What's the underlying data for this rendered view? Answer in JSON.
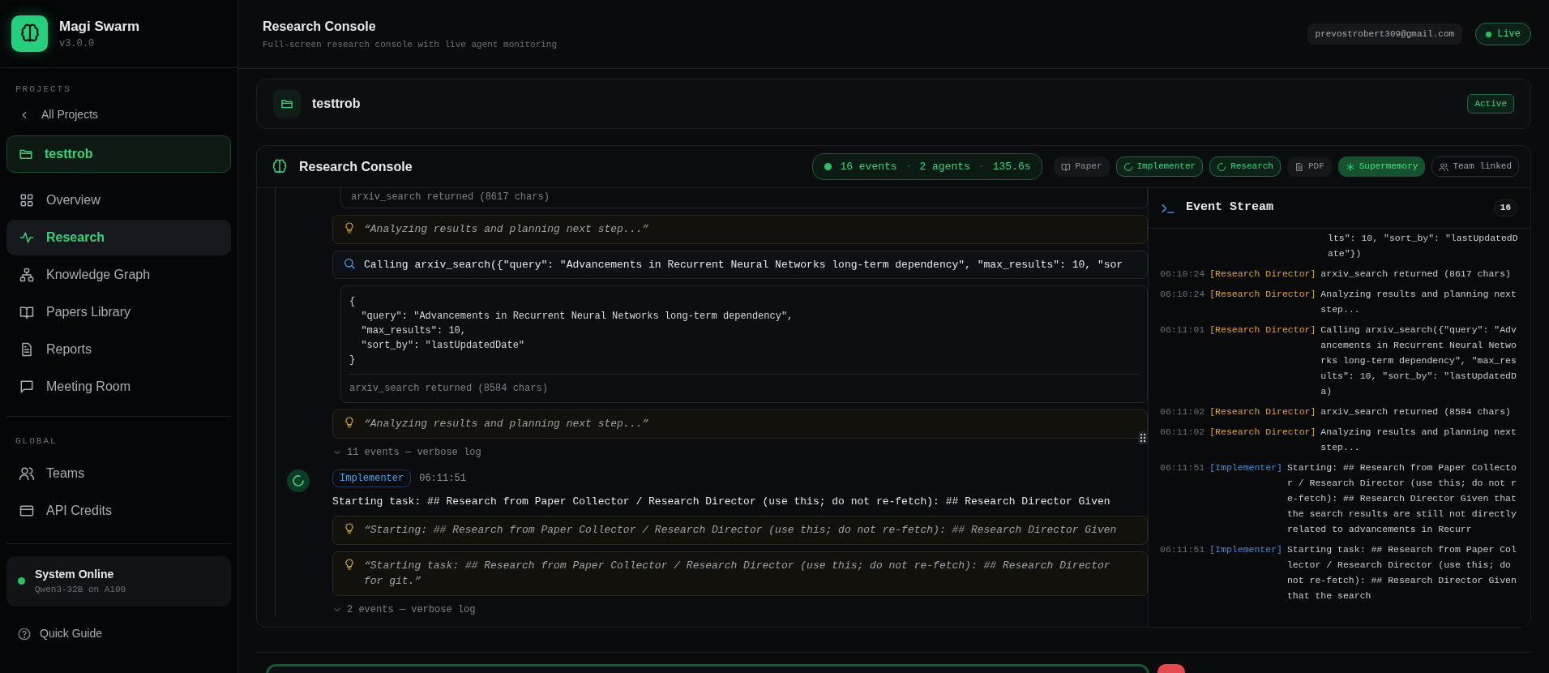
{
  "app": {
    "name": "Magi Swarm",
    "version": "v3.0.0"
  },
  "sidebar": {
    "projects_label": "PROJECTS",
    "back_link": "All Projects",
    "project": {
      "name": "testtrob",
      "selected": true
    },
    "nav": [
      {
        "label": "Overview",
        "kind": "grid",
        "selected": false
      },
      {
        "label": "Research",
        "kind": "pulse",
        "selected": true
      },
      {
        "label": "Knowledge Graph",
        "kind": "tree",
        "selected": false
      },
      {
        "label": "Papers Library",
        "kind": "book",
        "selected": false
      },
      {
        "label": "Reports",
        "kind": "file",
        "selected": false
      },
      {
        "label": "Meeting Room",
        "kind": "chat",
        "selected": false
      }
    ],
    "global_label": "GLOBAL",
    "global_nav": [
      {
        "label": "Teams",
        "kind": "users",
        "selected": false
      },
      {
        "label": "API Credits",
        "kind": "card",
        "selected": false
      }
    ],
    "status": {
      "title": "System Online",
      "detail": "Qwen3-32B on A100",
      "online": true
    },
    "quick_guide": "Quick Guide"
  },
  "header": {
    "title": "Research Console",
    "subtitle": "Full-screen research console with live agent monitoring",
    "email": "prevostrobert309@gmail.com",
    "live": {
      "label": "Live",
      "on": true
    }
  },
  "project_card": {
    "name": "testtrob",
    "status": "Active"
  },
  "console": {
    "title": "Research Console",
    "stats": [
      "16 events",
      "·",
      "2 agents",
      "·",
      "135.6s"
    ],
    "chips": [
      {
        "label": "Paper",
        "kind": "book",
        "active": false
      },
      {
        "label": "Implementer",
        "kind": "spinner",
        "active": true
      },
      {
        "label": "Research",
        "kind": "spinner",
        "active": true
      },
      {
        "label": "PDF",
        "kind": "file",
        "active": false
      },
      {
        "label": "Supermemory",
        "kind": "spark",
        "active": true
      },
      {
        "label": "Team linked",
        "kind": "users",
        "active": false
      }
    ],
    "log": [
      {
        "kind": "result",
        "text": "arxiv_search returned (8617 chars)"
      },
      {
        "kind": "thought",
        "lines": [
          "“Analyzing results and planning next step...”"
        ]
      },
      {
        "kind": "call",
        "text": "Calling arxiv_search({\"query\": \"Advancements in Recurrent Neural Networks long-term dependency\", \"max_results\": 10, \"sor",
        "code": [
          "{",
          "  \"query\": \"Advancements in Recurrent Neural Networks long-term dependency\",",
          "  \"max_results\": 10,",
          "  \"sort_by\": \"lastUpdatedDate\"",
          "}"
        ],
        "result": "arxiv_search returned (8584 chars)"
      },
      {
        "kind": "thought",
        "lines": [
          "“Analyzing results and planning next step...”"
        ]
      },
      {
        "kind": "expander",
        "text": "11 events — verbose log"
      },
      {
        "kind": "agent",
        "agent": "Implementer",
        "time": "06:11:51",
        "text": "Starting task: ## Research from Paper Collector / Research Director (use this; do not re-fetch): ## Research Director Given"
      },
      {
        "kind": "thought",
        "lines": [
          "“Starting: ## Research from Paper Collector / Research Director (use this; do not re-fetch): ## Research Director Given"
        ]
      },
      {
        "kind": "thought",
        "lines": [
          "“Starting task: ## Research from Paper Collector / Research Director (use this; do not re-fetch): ## Research Director",
          "for git.”"
        ]
      },
      {
        "kind": "expander",
        "text": "2 events — verbose log"
      }
    ],
    "stream": {
      "title": "Event Stream",
      "count": "16",
      "events": [
        {
          "kind": "continuation",
          "text": "lts\": 10, \"sort_by\": \"lastUpdatedDate\"})"
        },
        {
          "kind": "director",
          "time": "06:10:24",
          "agent": "[Research Director]",
          "text": "arxiv_search returned (8617 chars)"
        },
        {
          "kind": "director",
          "time": "06:10:24",
          "agent": "[Research Director]",
          "text": "Analyzing results and planning next step..."
        },
        {
          "kind": "director",
          "time": "06:11:01",
          "agent": "[Research Director]",
          "text": "Calling arxiv_search({\"query\": \"Advancements in Recurrent Neural Networks long-term dependency\", \"max_results\": 10, \"sort_by\": \"lastUpdatedDa)"
        },
        {
          "kind": "director",
          "time": "06:11:02",
          "agent": "[Research Director]",
          "text": "arxiv_search returned (8584 chars)"
        },
        {
          "kind": "director",
          "time": "06:11:02",
          "agent": "[Research Director]",
          "text": "Analyzing results and planning next step..."
        },
        {
          "kind": "implementer",
          "time": "06:11:51",
          "agent": "[Implementer]",
          "text": "Starting: ## Research from Paper Collector / Research Director (use this; do not re-fetch): ## Research Director Given that the search results are still not directly related to advancements in Recurr"
        },
        {
          "kind": "implementer",
          "time": "06:11:51",
          "agent": "[Implementer]",
          "text": "Starting task: ## Research from Paper Collector / Research Director (use this; do not re-fetch): ## Research Director Given that the search"
        }
      ]
    }
  }
}
